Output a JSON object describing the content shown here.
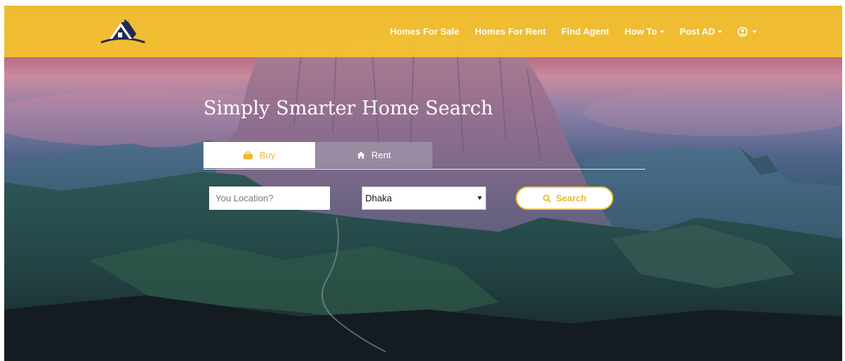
{
  "nav": {
    "links": [
      {
        "label": "Homes For Sale"
      },
      {
        "label": "Homes For Rent"
      },
      {
        "label": "Find Agent"
      },
      {
        "label": "How To",
        "dropdown": true
      },
      {
        "label": "Post AD",
        "dropdown": true
      }
    ],
    "user_menu_icon": "user-circle-icon",
    "logo_icon": "house-logo-icon"
  },
  "hero": {
    "headline": "Simply Smarter Home Search"
  },
  "search": {
    "tabs": [
      {
        "label": "Buy",
        "icon": "shopping-bag-icon",
        "active": true
      },
      {
        "label": "Rent",
        "icon": "home-icon",
        "active": false
      }
    ],
    "location_placeholder": "You Location?",
    "location_value": "",
    "city_selected": "Dhaka",
    "search_label": "Search",
    "search_icon": "search-icon"
  },
  "colors": {
    "brand_yellow": "#f6c42c",
    "accent_text": "#f0b92a",
    "nav_text": "#ffffff"
  }
}
